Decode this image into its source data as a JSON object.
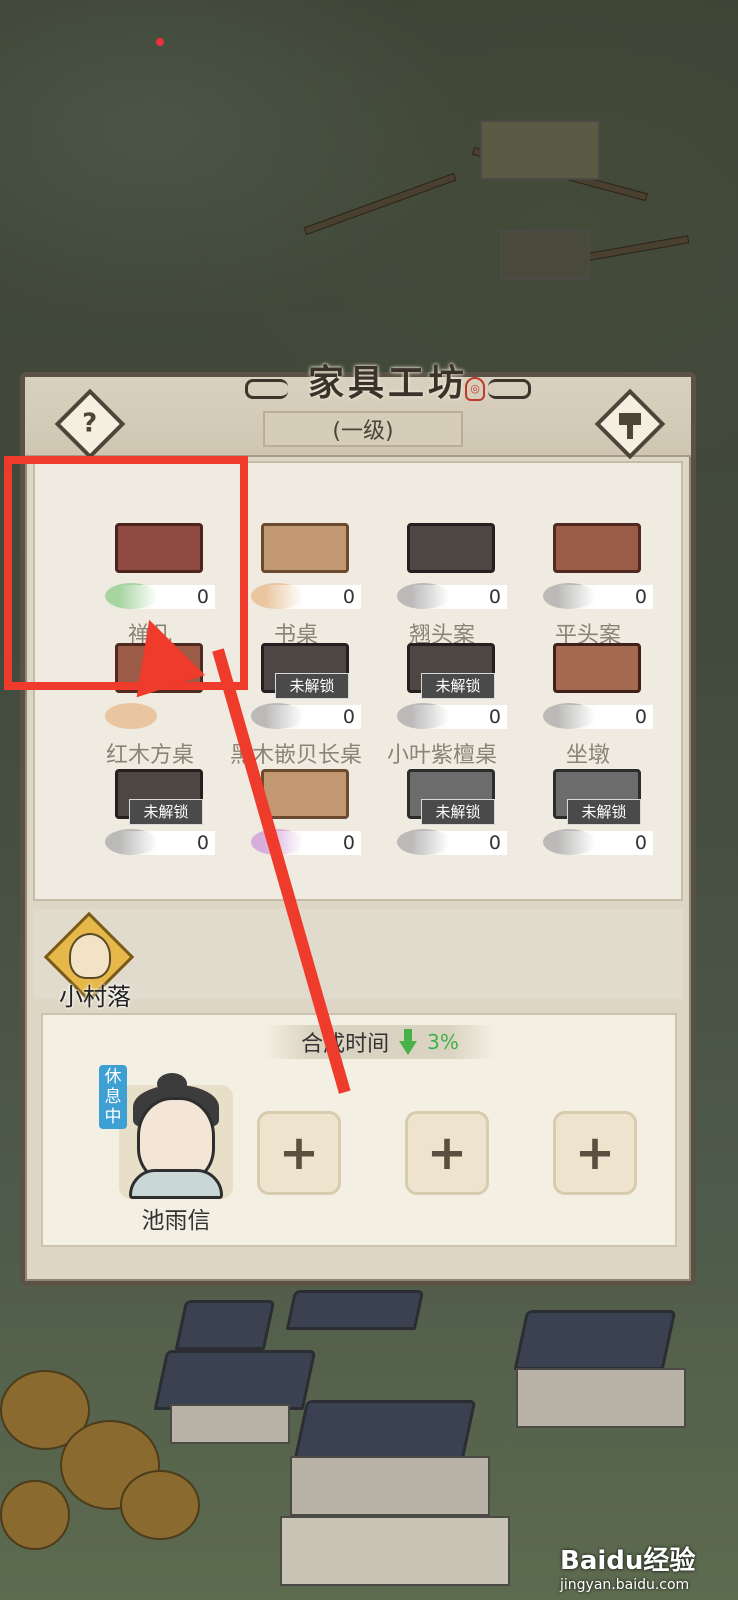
{
  "panel": {
    "title": "家具工坊",
    "level": "(一级)",
    "help_symbol": "?"
  },
  "furniture": [
    {
      "name": "禅几",
      "count": "0",
      "locked": false
    },
    {
      "name": "书桌",
      "count": "0",
      "locked": false
    },
    {
      "name": "翘头案",
      "count": "0",
      "locked": false
    },
    {
      "name": "平头案",
      "count": "0",
      "locked": false
    },
    {
      "name": "红木方桌",
      "count": "",
      "locked": false
    },
    {
      "name": "黑木嵌贝长桌",
      "count": "0",
      "locked": true
    },
    {
      "name": "小叶紫檀桌",
      "count": "0",
      "locked": true
    },
    {
      "name": "坐墩",
      "count": "0",
      "locked": false
    },
    {
      "name": "",
      "count": "0",
      "locked": true
    },
    {
      "name": "",
      "count": "0",
      "locked": false
    },
    {
      "name": "",
      "count": "0",
      "locked": true
    },
    {
      "name": "",
      "count": "0",
      "locked": true
    }
  ],
  "locked_label": "未解锁",
  "village": {
    "label": "小村落"
  },
  "synthesis": {
    "label": "合成时间",
    "bonus": "3%"
  },
  "worker": {
    "name": "池雨信",
    "status": "休息中"
  },
  "slots": [
    "+",
    "+",
    "+"
  ],
  "watermark": {
    "brand": "Baidu经验",
    "url": "jingyan.baidu.com"
  },
  "colors": {
    "annotation_red": "#ee3b2b",
    "bonus_green": "#3fb24a",
    "rest_blue": "#3d9fd2"
  }
}
